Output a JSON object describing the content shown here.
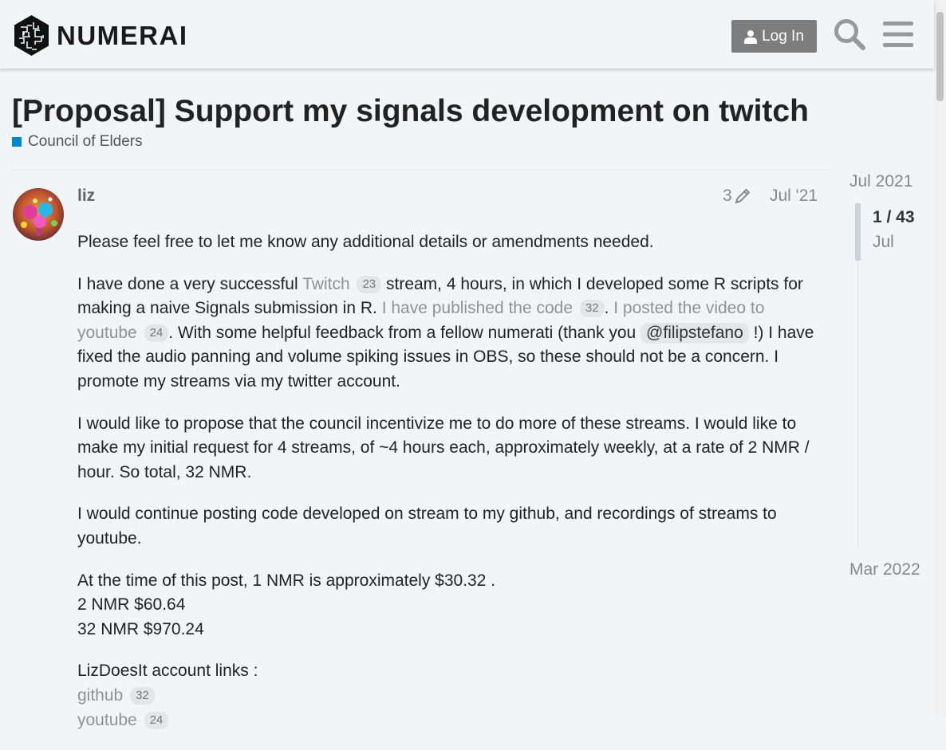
{
  "header": {
    "logo_text": "NUMERAI",
    "login_label": "Log In",
    "search_icon": "search-icon",
    "menu_icon": "hamburger-menu-icon"
  },
  "topic": {
    "title": "[Proposal] Support my signals development on twitch",
    "category": "Council of Elders",
    "category_color": "#0088cc"
  },
  "post": {
    "username": "liz",
    "edit_count": "3",
    "date": "Jul '21",
    "p1": "Please feel free to let me know any additional details or amendments needed.",
    "p2": {
      "t1": "I have done a very successful ",
      "link1": "Twitch",
      "link1_clicks": "23",
      "t2": " stream, 4 hours, in which I developed some R scripts for making a naive Signals submission in R. ",
      "link2": "I have published the code",
      "link2_clicks": "32",
      "t3": ". ",
      "link3": "I posted the video to youtube",
      "link3_clicks": "24",
      "t4": ". With some helpful feedback from a fellow numerati (thank you ",
      "mention": "@filipstefano",
      "t5": " !) I have fixed the audio panning and volume spiking issues in OBS, so these should not be a concern. I promote my streams via my twitter account."
    },
    "p3": "I would like to propose that the council incentivize me to do more of these streams. I would like to make my initial request for 4 streams, of ~4 hours each, approximately weekly, at a rate of 2 NMR / hour. So total, 32 NMR.",
    "p4": "I would continue posting code developed on stream to my github, and recordings of streams to youtube.",
    "p5": {
      "line1": "At the time of this post, 1 NMR is approximately $30.32 .",
      "line2": "2 NMR $60.64",
      "line3": "32 NMR $970.24"
    },
    "p6": {
      "heading": "LizDoesIt account links :",
      "github_label": "github",
      "github_clicks": "32",
      "youtube_label": "youtube",
      "youtube_clicks": "24"
    }
  },
  "timeline": {
    "start": "Jul 2021",
    "position": "1 / 43",
    "position_date": "Jul",
    "end": "Mar 2022"
  }
}
